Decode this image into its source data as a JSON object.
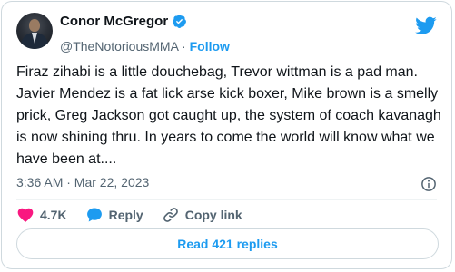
{
  "author": {
    "name": "Conor McGregor",
    "handle": "@TheNotoriousMMA",
    "separator": "·",
    "follow_label": "Follow"
  },
  "tweet": {
    "text": "Firaz zihabi is a little douchebag, Trevor wittman is a pad man. Javier Mendez is a fat lick arse kick boxer, Mike brown is a smelly prick, Greg Jackson got caught up, the system of coach kavanagh is now shining thru. In years to come the world will know what we have been at....",
    "timestamp": "3:36 AM · Mar 22, 2023"
  },
  "actions": {
    "like_count": "4.7K",
    "reply_label": "Reply",
    "copy_link_label": "Copy link",
    "read_replies_label": "Read 421 replies"
  },
  "colors": {
    "accent": "#1d9bf0",
    "like": "#f91880",
    "text": "#0f1419",
    "secondary": "#536471"
  },
  "icons": [
    "verified-badge-icon",
    "twitter-bird-icon",
    "info-icon",
    "heart-icon",
    "reply-bubble-icon",
    "link-icon"
  ]
}
